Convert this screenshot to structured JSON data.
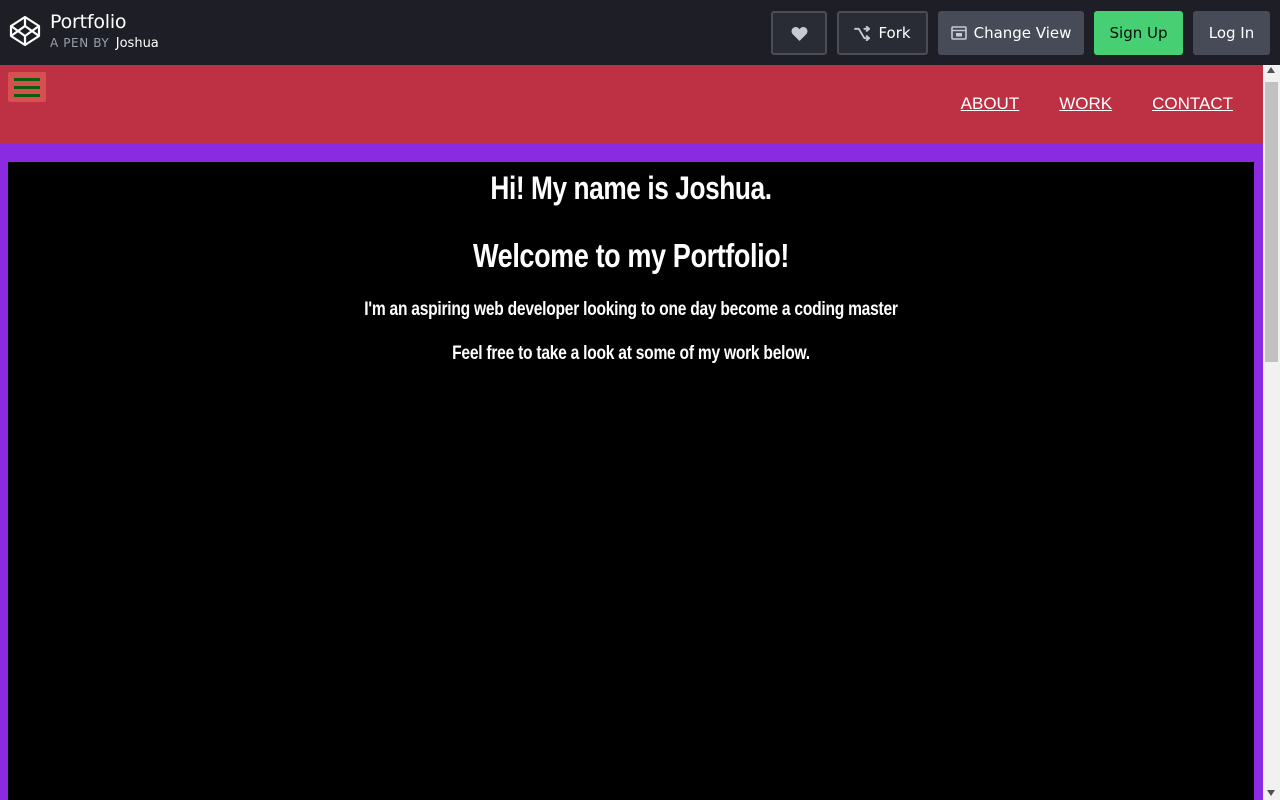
{
  "header": {
    "title": "Portfolio",
    "by_prefix": "A PEN BY",
    "author": "Joshua",
    "logo_icon": "codepen-logo-icon",
    "buttons": {
      "heart_icon": "heart-icon",
      "fork_label": "Fork",
      "fork_icon": "fork-icon",
      "change_view_label": "Change View",
      "change_view_icon": "change-view-icon",
      "signup_label": "Sign Up",
      "login_label": "Log In"
    },
    "colors": {
      "background": "#1e1f26",
      "signup": "#47cf73",
      "secondary": "#474a57"
    }
  },
  "preview": {
    "nav": {
      "menu_icon": "hamburger-icon",
      "links": [
        "ABOUT",
        "WORK",
        "CONTACT"
      ],
      "background": "#be3144"
    },
    "welcome": {
      "heading": "Hi! My name is Joshua.",
      "subheading": "Welcome to my Portfolio!",
      "line1": "I'm an aspiring web developer looking to one day become a coding master",
      "line2": "Feel free to take a look at some of my work below.",
      "background": "#000000",
      "border_color": "#8a2be2"
    }
  }
}
